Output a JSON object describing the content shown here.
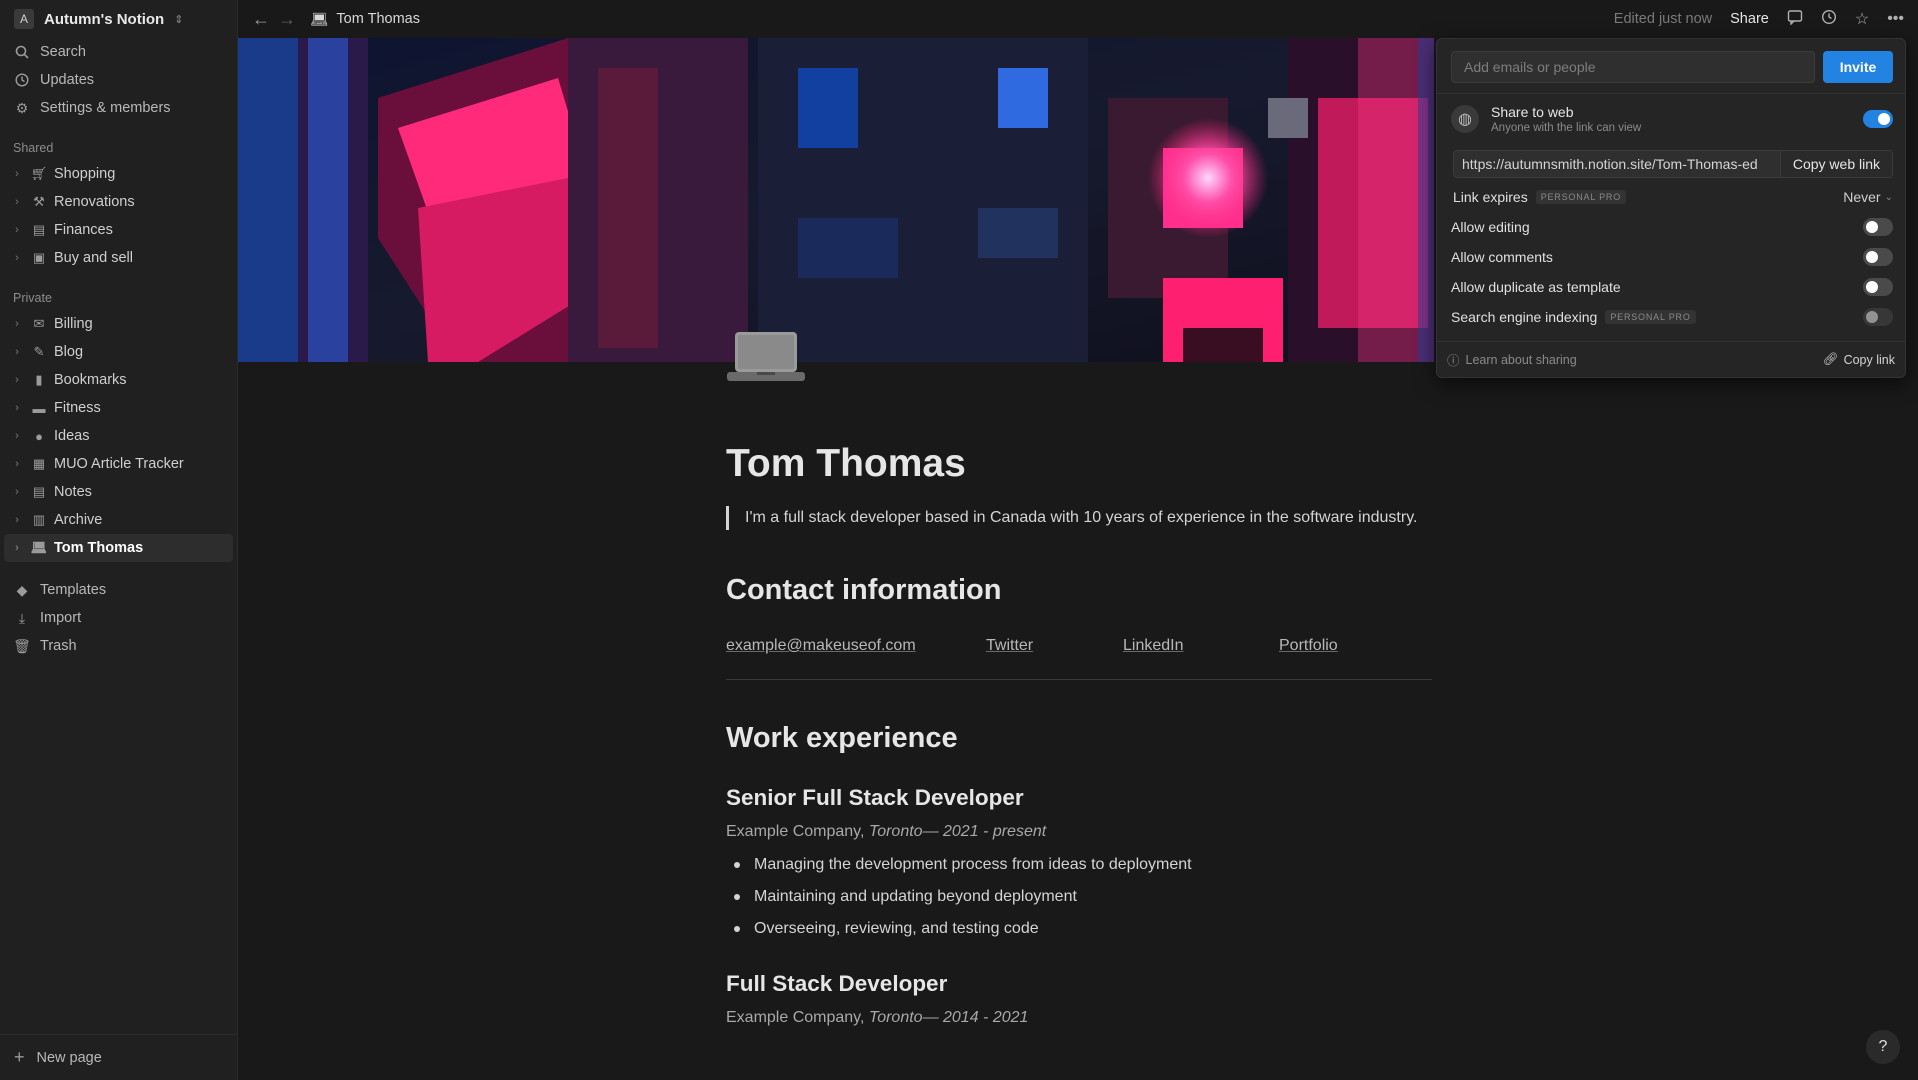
{
  "workspace": {
    "avatar": "A",
    "name": "Autumn's Notion"
  },
  "sidebar": {
    "top": [
      {
        "label": "Search"
      },
      {
        "label": "Updates"
      },
      {
        "label": "Settings & members"
      }
    ],
    "shared_title": "Shared",
    "shared": [
      {
        "label": "Shopping"
      },
      {
        "label": "Renovations"
      },
      {
        "label": "Finances"
      },
      {
        "label": "Buy and sell"
      }
    ],
    "private_title": "Private",
    "private": [
      {
        "label": "Billing"
      },
      {
        "label": "Blog"
      },
      {
        "label": "Bookmarks"
      },
      {
        "label": "Fitness"
      },
      {
        "label": "Ideas"
      },
      {
        "label": "MUO Article Tracker"
      },
      {
        "label": "Notes"
      },
      {
        "label": "Archive"
      },
      {
        "label": "Tom Thomas"
      }
    ],
    "bottom": [
      {
        "label": "Templates"
      },
      {
        "label": "Import"
      },
      {
        "label": "Trash"
      }
    ],
    "new_page": "New page"
  },
  "topbar": {
    "breadcrumb": "Tom Thomas",
    "edited": "Edited just now",
    "share": "Share"
  },
  "share_panel": {
    "invite_placeholder": "Add emails or people",
    "invite_button": "Invite",
    "share_web_title": "Share to web",
    "share_web_sub": "Anyone with the link can view",
    "share_web_on": true,
    "url": "https://autumnsmith.notion.site/Tom-Thomas-ed",
    "copy_web_link": "Copy web link",
    "link_expires": "Link expires",
    "personal_pro": "PERSONAL PRO",
    "never": "Never",
    "allow_editing": "Allow editing",
    "allow_comments": "Allow comments",
    "allow_duplicate": "Allow duplicate as template",
    "search_indexing": "Search engine indexing",
    "learn": "Learn about sharing",
    "copy_link": "Copy link"
  },
  "doc": {
    "title": "Tom Thomas",
    "quote": "I'm a full stack developer based in Canada with 10 years of experience in the software industry.",
    "contact_heading": "Contact information",
    "links": [
      "example@makeuseof.com",
      "Twitter",
      "LinkedIn",
      "Portfolio"
    ],
    "work_heading": "Work experience",
    "jobs": [
      {
        "title": "Senior Full Stack Developer",
        "company": "Example Company,",
        "detail": "Toronto— 2021 - present",
        "bullets": [
          "Managing the development process from ideas to deployment",
          "Maintaining and updating beyond deployment",
          "Overseeing, reviewing, and testing code"
        ]
      },
      {
        "title": "Full Stack Developer",
        "company": "Example Company,",
        "detail": "Toronto— 2014 - 2021"
      }
    ]
  },
  "help": "?"
}
